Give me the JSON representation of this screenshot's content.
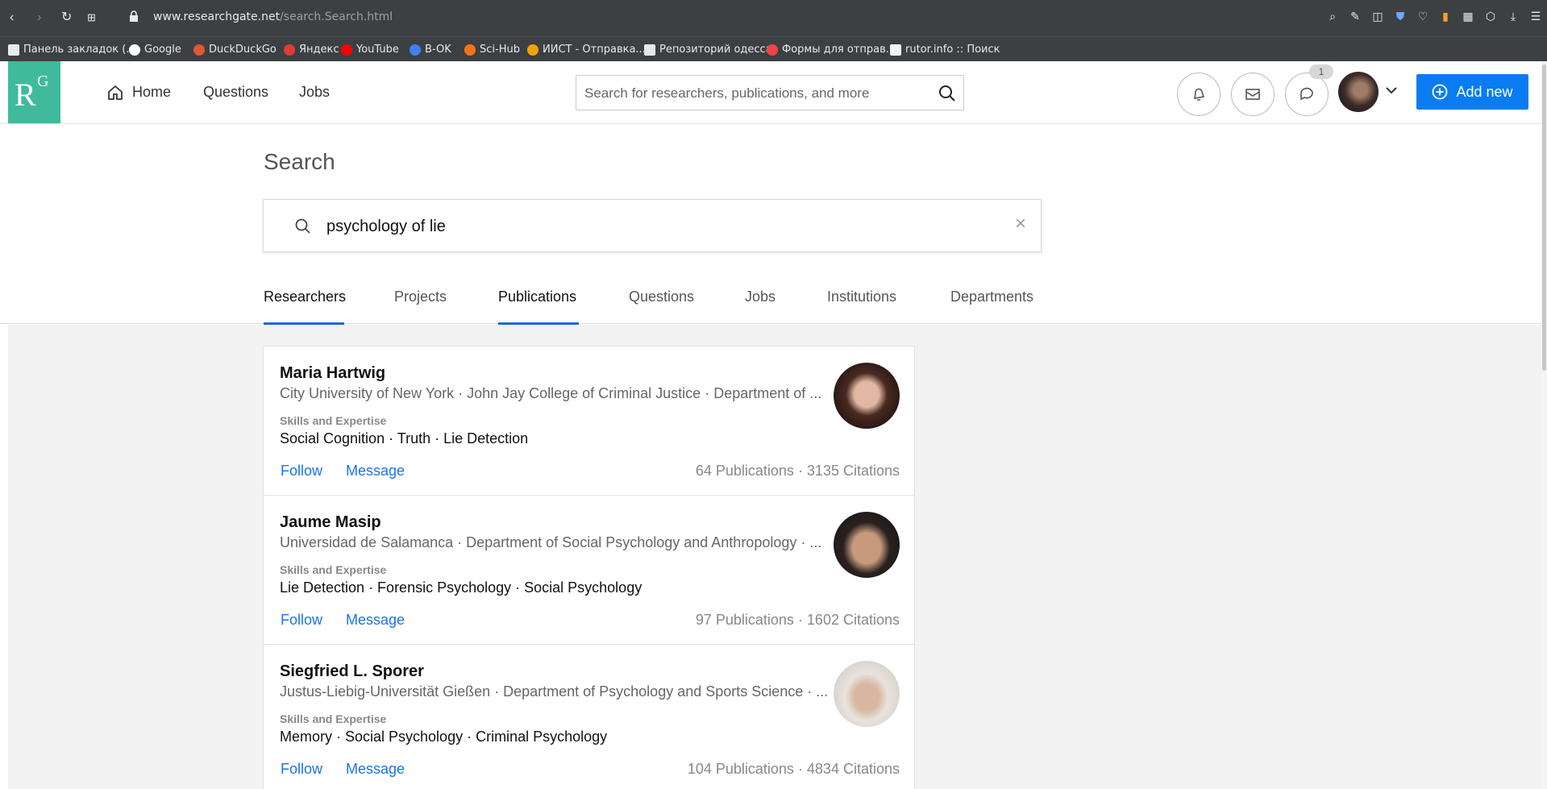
{
  "browser": {
    "url_domain": "www.researchgate.net",
    "url_path": "/search.Search.html",
    "bookmarks": [
      {
        "label": "Панель закладок (...",
        "color": "#e8eaed"
      },
      {
        "label": "Google",
        "color": "#ffffff"
      },
      {
        "label": "DuckDuckGo",
        "color": "#de5833"
      },
      {
        "label": "Яндекс",
        "color": "#e53935"
      },
      {
        "label": "YouTube",
        "color": "#ff0000"
      },
      {
        "label": "B-OK",
        "color": "#3b82f6"
      },
      {
        "label": "Sci-Hub",
        "color": "#f97316"
      },
      {
        "label": "ИИСТ - Отправка...",
        "color": "#f59e0b"
      },
      {
        "label": "Репозиторий одесса",
        "color": "#e5e7eb"
      },
      {
        "label": "Формы для отправ...",
        "color": "#ef4444"
      },
      {
        "label": "rutor.info :: Поиск",
        "color": "#f3f4f6"
      }
    ]
  },
  "header": {
    "logo_r": "R",
    "logo_g": "G",
    "nav": [
      "Home",
      "Questions",
      "Jobs"
    ],
    "search_placeholder": "Search for researchers, publications, and more",
    "notification_count": "1",
    "add_new_label": "Add new",
    "accent_color": "#0a7cf2",
    "logo_color": "#40ba9c"
  },
  "search": {
    "title": "Search",
    "query": "psychology of lie",
    "tabs": [
      "Researchers",
      "Projects",
      "Publications",
      "Questions",
      "Jobs",
      "Institutions",
      "Departments"
    ],
    "active_tabs": [
      "Researchers",
      "Publications"
    ]
  },
  "results": [
    {
      "name": "Maria Hartwig",
      "institution": "City University of New York · John Jay College of Criminal Justice · Department of ...",
      "skills_label": "Skills and Expertise",
      "skills": "Social Cognition · Truth · Lie Detection",
      "follow": "Follow",
      "message": "Message",
      "stats": "64 Publications · 3135 Citations"
    },
    {
      "name": "Jaume Masip",
      "institution": "Universidad de Salamanca · Department of Social Psychology and Anthropology · ...",
      "skills_label": "Skills and Expertise",
      "skills": "Lie Detection · Forensic Psychology · Social Psychology",
      "follow": "Follow",
      "message": "Message",
      "stats": "97 Publications · 1602 Citations"
    },
    {
      "name": "Siegfried L. Sporer",
      "institution": "Justus-Liebig-Universität Gießen · Department of Psychology and Sports Science · ...",
      "skills_label": "Skills and Expertise",
      "skills": "Memory · Social Psychology · Criminal Psychology",
      "follow": "Follow",
      "message": "Message",
      "stats": "104 Publications · 4834 Citations"
    }
  ]
}
